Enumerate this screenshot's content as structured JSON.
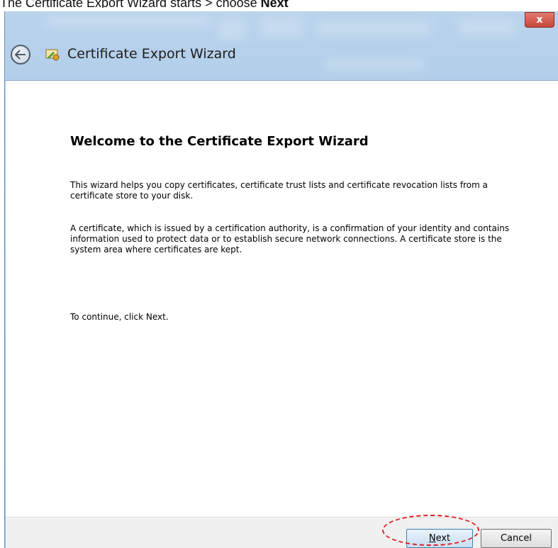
{
  "caption": {
    "prefix": "The Certificate Export Wizard starts > choose ",
    "emphasis": "Next"
  },
  "window": {
    "title": "Certificate Export Wizard",
    "close_label": "x"
  },
  "wizard": {
    "heading": "Welcome to the Certificate Export Wizard",
    "paragraph1": "This wizard helps you copy certificates, certificate trust lists and certificate revocation lists from a certificate store to your disk.",
    "paragraph2": "A certificate, which is issued by a certification authority, is a confirmation of your identity and contains information used to protect data or to establish secure network connections. A certificate store is the system area where certificates are kept.",
    "paragraph3": "To continue, click Next."
  },
  "buttons": {
    "next_mnemonic": "N",
    "next_rest": "ext",
    "cancel_label": "Cancel"
  },
  "colors": {
    "highlight": "#e02020",
    "close": "#c7463a"
  }
}
